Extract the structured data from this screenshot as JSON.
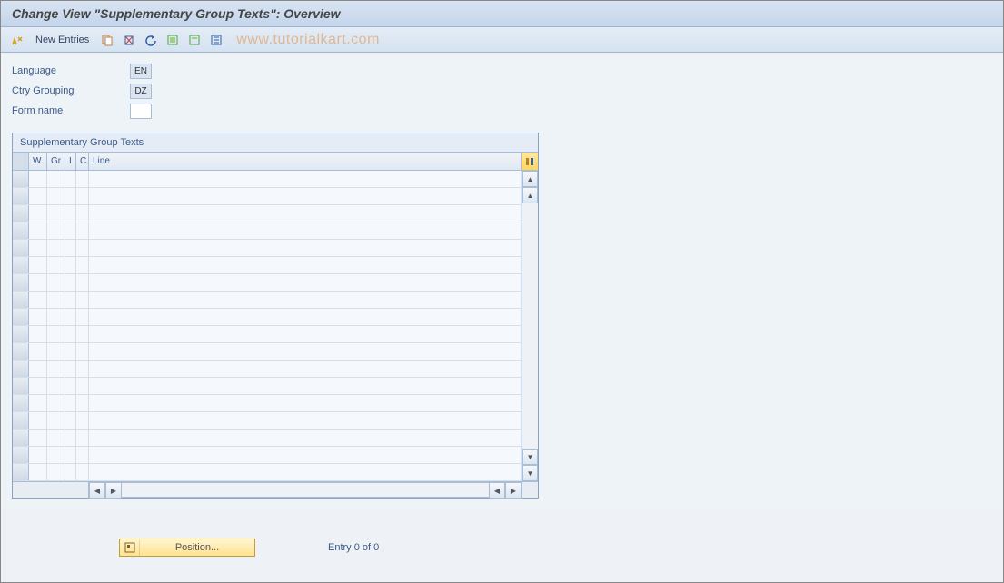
{
  "title": "Change View \"Supplementary Group Texts\": Overview",
  "toolbar": {
    "new_entries_label": "New Entries"
  },
  "watermark": "www.tutorialkart.com",
  "fields": {
    "language_label": "Language",
    "language_value": "EN",
    "ctry_grouping_label": "Ctry Grouping",
    "ctry_grouping_value": "DZ",
    "form_name_label": "Form name",
    "form_name_value": ""
  },
  "table": {
    "title": "Supplementary Group Texts",
    "columns": {
      "w": "W.",
      "gr": "Gr",
      "i": "I",
      "c": "C",
      "line": "Line"
    },
    "row_count": 18
  },
  "footer": {
    "position_label": "Position...",
    "entry_text": "Entry 0 of 0"
  }
}
